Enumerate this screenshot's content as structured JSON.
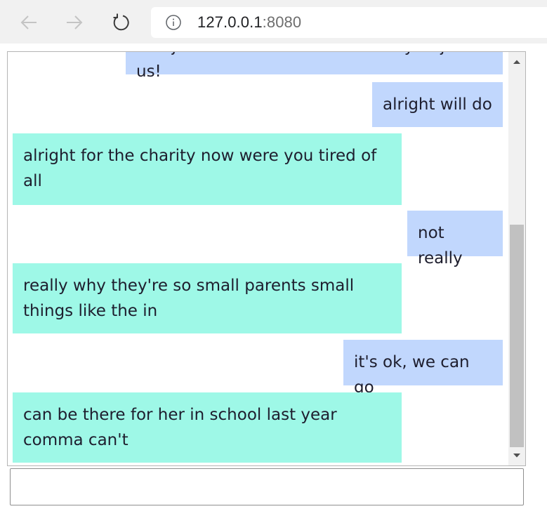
{
  "browser": {
    "back_icon": "arrow-left-icon",
    "forward_icon": "arrow-right-icon",
    "reload_icon": "reload-icon",
    "info_icon": "info-icon",
    "url_host": "127.0.0.1",
    "url_port": ":8080"
  },
  "chat": {
    "messages": [
      {
        "sender": "me",
        "text": "She just checked back. She's okay to join us!"
      },
      {
        "sender": "me",
        "text": "alright will do"
      },
      {
        "sender": "them",
        "text": "alright for the charity now were you tired of all"
      },
      {
        "sender": "me",
        "text": "not really"
      },
      {
        "sender": "them",
        "text": "really why they're so small parents small things like the in"
      },
      {
        "sender": "me",
        "text": "it's ok, we can go"
      },
      {
        "sender": "them",
        "text": "can be there for her in school last year comma can't"
      }
    ],
    "composer": {
      "value": "",
      "placeholder": ""
    }
  },
  "colors": {
    "me_bubble": "#c1d7fd",
    "them_bubble": "#9ef8e7"
  }
}
